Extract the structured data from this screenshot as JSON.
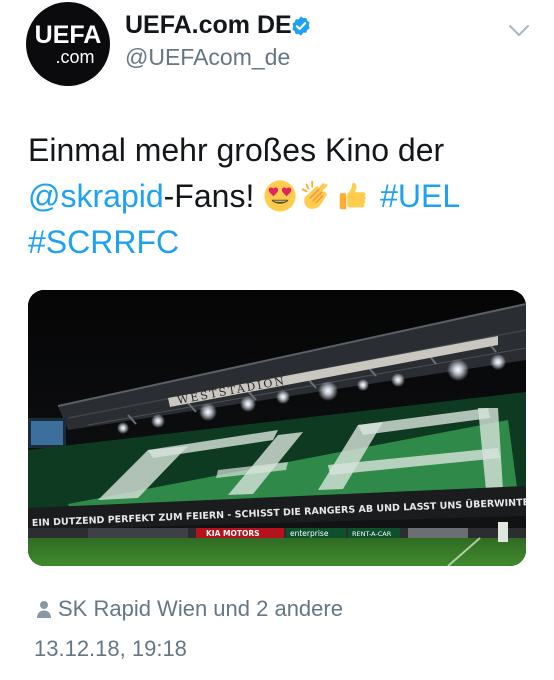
{
  "account": {
    "avatar_main": "UEFA",
    "avatar_sub": ".com",
    "display_name": "UEFA.com DE",
    "verified": true,
    "handle": "@UEFAcom_de"
  },
  "tweet": {
    "line1": "Einmal mehr großes Kino der",
    "mention": "@skrapid",
    "line2_after_mention": "-Fans!",
    "emojis": [
      "heart-eyes-face",
      "clapping-hands",
      "thumbs-up"
    ],
    "hashtag1": "#UEL",
    "hashtag2": "#SCRRFC"
  },
  "photo": {
    "stand_name": "WESTSTADION",
    "banner_text": "EIN DUTZEND PERFEKT ZUM FEIERN - SCHISST DIE RANGERS AB UND LASST UNS ÜBERWINTERN",
    "ad_sponsor_1": "KIA MOTORS",
    "ad_sponsor_2": "enterprise",
    "ad_sponsor_3": "RENT-A-CAR"
  },
  "footer": {
    "liked_by": "SK Rapid Wien und 2 andere",
    "timestamp": "13.12.18, 19:18"
  },
  "colors": {
    "link": "#1da1f2",
    "secondary_text": "#657786",
    "primary_text": "#14171a",
    "verified_badge": "#1da1f2"
  }
}
